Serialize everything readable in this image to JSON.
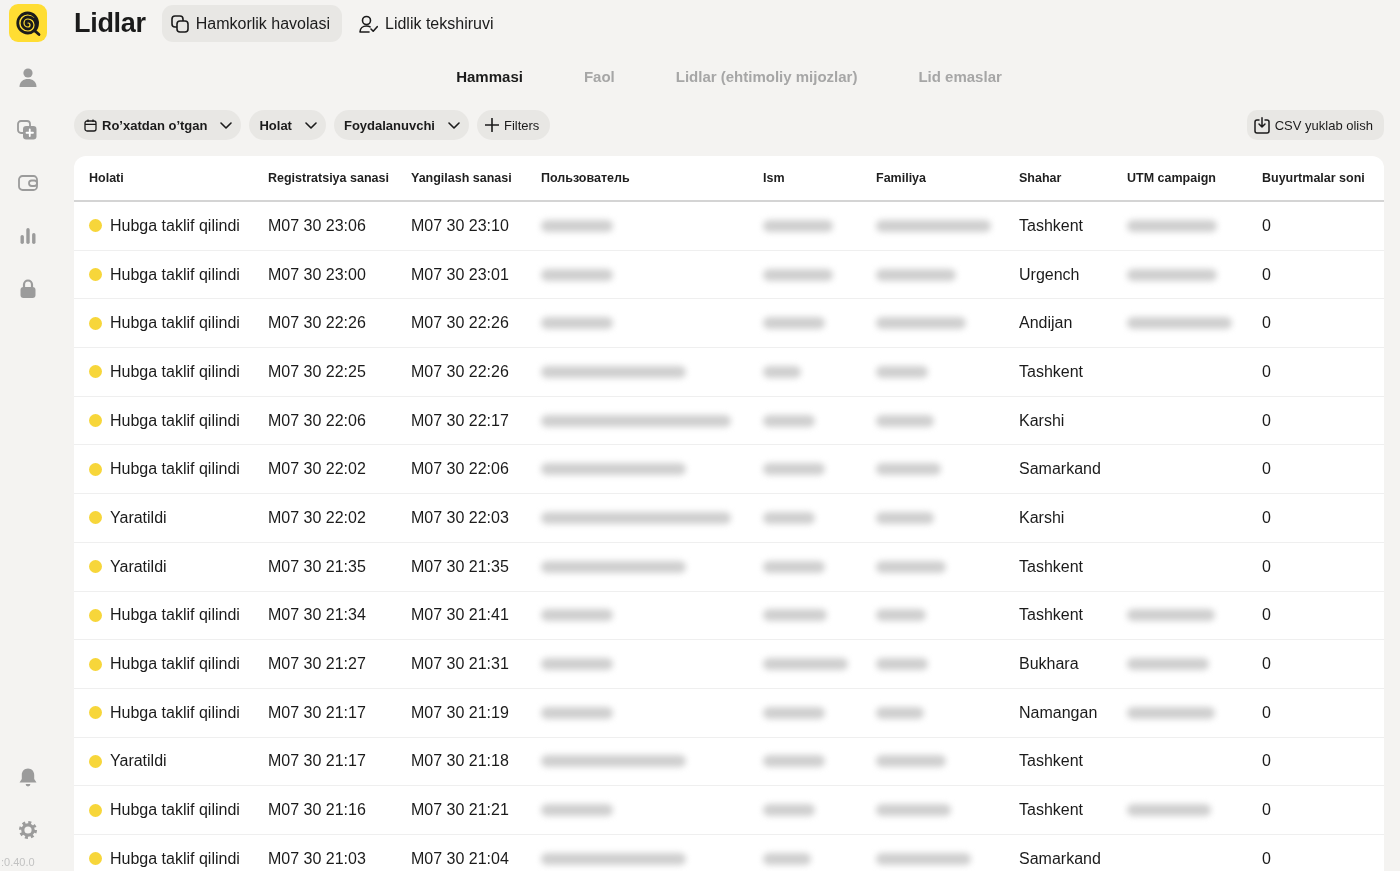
{
  "sidebar": {
    "version": ":0.40.0"
  },
  "header": {
    "title": "Lidlar",
    "actions": [
      {
        "label": "Hamkorlik havolasi",
        "kind": "filled"
      },
      {
        "label": "Lidlik tekshiruvi",
        "kind": "plain"
      }
    ]
  },
  "tabs": [
    {
      "label": "Hammasi",
      "selected": true
    },
    {
      "label": "Faol",
      "selected": false
    },
    {
      "label": "Lidlar (ehtimoliy mijozlar)",
      "selected": false
    },
    {
      "label": "Lid emaslar",
      "selected": false
    }
  ],
  "filters": [
    {
      "label": "Ro’xatdan o’tgan",
      "kind": "date"
    },
    {
      "label": "Holat",
      "kind": "select"
    },
    {
      "label": "Foydalanuvchi",
      "kind": "select"
    },
    {
      "label": "Filters",
      "kind": "add"
    }
  ],
  "export_button": {
    "label": "CSV yuklab olish"
  },
  "table": {
    "columns": [
      "Holati",
      "Registratsiya sanasi",
      "Yangilash sanasi",
      "Пользователь",
      "Ism",
      "Familiya",
      "Shahar",
      "UTM campaign",
      "Buyurtmalar soni"
    ],
    "rows": [
      {
        "status": "Hubga taklif qilindi",
        "registered": "M07 30 23:06",
        "updated": "M07 30 23:10",
        "city": "Tashkent",
        "utm_blurred": true,
        "orders": "0"
      },
      {
        "status": "Hubga taklif qilindi",
        "registered": "M07 30 23:00",
        "updated": "M07 30 23:01",
        "city": "Urgench",
        "utm_blurred": true,
        "orders": "0"
      },
      {
        "status": "Hubga taklif qilindi",
        "registered": "M07 30 22:26",
        "updated": "M07 30 22:26",
        "city": "Andijan",
        "utm_blurred": true,
        "orders": "0"
      },
      {
        "status": "Hubga taklif qilindi",
        "registered": "M07 30 22:25",
        "updated": "M07 30 22:26",
        "city": "Tashkent",
        "utm_blurred": false,
        "orders": "0"
      },
      {
        "status": "Hubga taklif qilindi",
        "registered": "M07 30 22:06",
        "updated": "M07 30 22:17",
        "city": "Karshi",
        "utm_blurred": false,
        "orders": "0"
      },
      {
        "status": "Hubga taklif qilindi",
        "registered": "M07 30 22:02",
        "updated": "M07 30 22:06",
        "city": "Samarkand",
        "utm_blurred": false,
        "orders": "0"
      },
      {
        "status": "Yaratildi",
        "registered": "M07 30 22:02",
        "updated": "M07 30 22:03",
        "city": "Karshi",
        "utm_blurred": false,
        "orders": "0"
      },
      {
        "status": "Yaratildi",
        "registered": "M07 30 21:35",
        "updated": "M07 30 21:35",
        "city": "Tashkent",
        "utm_blurred": false,
        "orders": "0"
      },
      {
        "status": "Hubga taklif qilindi",
        "registered": "M07 30 21:34",
        "updated": "M07 30 21:41",
        "city": "Tashkent",
        "utm_blurred": true,
        "orders": "0"
      },
      {
        "status": "Hubga taklif qilindi",
        "registered": "M07 30 21:27",
        "updated": "M07 30 21:31",
        "city": "Bukhara",
        "utm_blurred": true,
        "orders": "0"
      },
      {
        "status": "Hubga taklif qilindi",
        "registered": "M07 30 21:17",
        "updated": "M07 30 21:19",
        "city": "Namangan",
        "utm_blurred": true,
        "orders": "0"
      },
      {
        "status": "Yaratildi",
        "registered": "M07 30 21:17",
        "updated": "M07 30 21:18",
        "city": "Tashkent",
        "utm_blurred": false,
        "orders": "0"
      },
      {
        "status": "Hubga taklif qilindi",
        "registered": "M07 30 21:16",
        "updated": "M07 30 21:21",
        "city": "Tashkent",
        "utm_blurred": true,
        "orders": "0"
      },
      {
        "status": "Hubga taklif qilindi",
        "registered": "M07 30 21:03",
        "updated": "M07 30 21:04",
        "city": "Samarkand",
        "utm_blurred": false,
        "orders": "0"
      }
    ]
  }
}
